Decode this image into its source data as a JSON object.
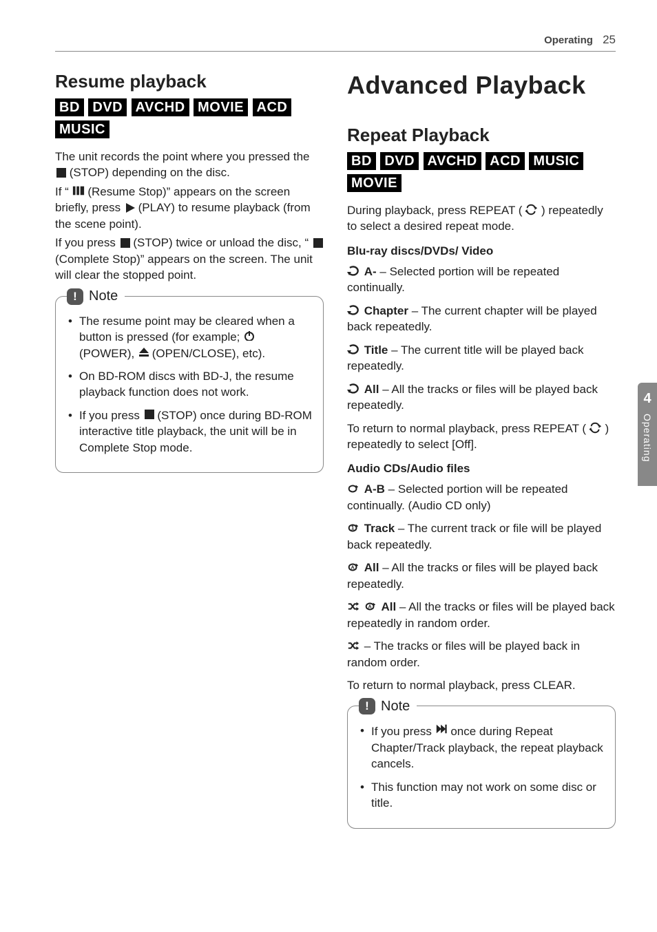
{
  "header": {
    "section": "Operating",
    "page": "25"
  },
  "side_tab": {
    "num": "4",
    "label": "Operating"
  },
  "left": {
    "title": "Resume playback",
    "badges": [
      "BD",
      "DVD",
      "AVCHD",
      "MOVIE",
      "ACD",
      "MUSIC"
    ],
    "p1a": "The unit records the point where you pressed the ",
    "p1b": " (STOP) depending on the disc.",
    "p2a": "If “",
    "p2b": " (Resume Stop)” appears on the screen briefly, press ",
    "p2c": " (PLAY) to resume playback (from the scene point).",
    "p3a": "If you press ",
    "p3b": " (STOP) twice or unload the disc, “",
    "p3c": "(Complete Stop)” appears on the screen. The unit will clear the stopped point.",
    "note_label": "Note",
    "note1a": "The resume point may be cleared when a button is pressed (for example; ",
    "note1b": " (POWER), ",
    "note1c": " (OPEN/CLOSE), etc).",
    "note2": "On BD-ROM discs with BD-J, the resume playback function does not work.",
    "note3a": "If you press ",
    "note3b": " (STOP) once during BD-ROM interactive title playback, the unit will be in Complete Stop mode."
  },
  "right": {
    "title": "Advanced Playback",
    "sub_title": "Repeat Playback",
    "badges": [
      "BD",
      "DVD",
      "AVCHD",
      "ACD",
      "MUSIC",
      "MOVIE"
    ],
    "intro_a": "During playback, press REPEAT (",
    "intro_b": ") repeatedly to select a desired repeat mode.",
    "heading_bd": "Blu-ray discs/DVDs/ Video",
    "bd_a_label": "A-",
    "bd_a_text": " – Selected portion will be repeated continually.",
    "bd_ch_label": "Chapter",
    "bd_ch_text": " – The current chapter will be played back repeatedly.",
    "bd_ti_label": "Title",
    "bd_ti_text": " – The current title will be played back repeatedly.",
    "bd_all_label": "All",
    "bd_all_text": " – All the tracks or files will be played back repeatedly.",
    "bd_return_a": "To return to normal playback, press REPEAT (",
    "bd_return_b": ") repeatedly to select [Off].",
    "heading_audio": "Audio CDs/Audio files",
    "au_ab_label": "A-B",
    "au_ab_text": " – Selected portion will be repeated continually. (Audio CD only)",
    "au_tr_label": "Track",
    "au_tr_text": " – The current track or file will be played back repeatedly.",
    "au_all_label": "All",
    "au_all_text": " – All the tracks or files will be played back repeatedly.",
    "au_shall_label": "All",
    "au_shall_text": " – All the tracks or files will be played back repeatedly in random order.",
    "au_sh_text": " – The tracks or files will be played back in random order.",
    "au_return": "To return to normal playback, press CLEAR.",
    "note_label": "Note",
    "note1a": "If you press ",
    "note1b": " once during Repeat Chapter/Track playback, the repeat playback cancels.",
    "note2": "This function may not work on some disc or title."
  }
}
